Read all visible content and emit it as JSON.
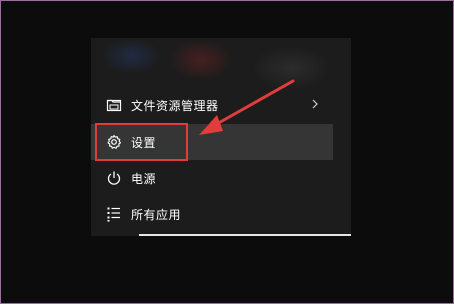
{
  "start_menu": {
    "items": [
      {
        "label": "文件资源管理器",
        "icon": "folder-icon",
        "has_submenu": true
      },
      {
        "label": "设置",
        "icon": "gear-icon",
        "highlighted": true
      },
      {
        "label": "电源",
        "icon": "power-icon"
      },
      {
        "label": "所有应用",
        "icon": "list-icon"
      }
    ]
  },
  "annotation": {
    "box_color": "#e23c3c",
    "arrow_color": "#e23c3c"
  }
}
